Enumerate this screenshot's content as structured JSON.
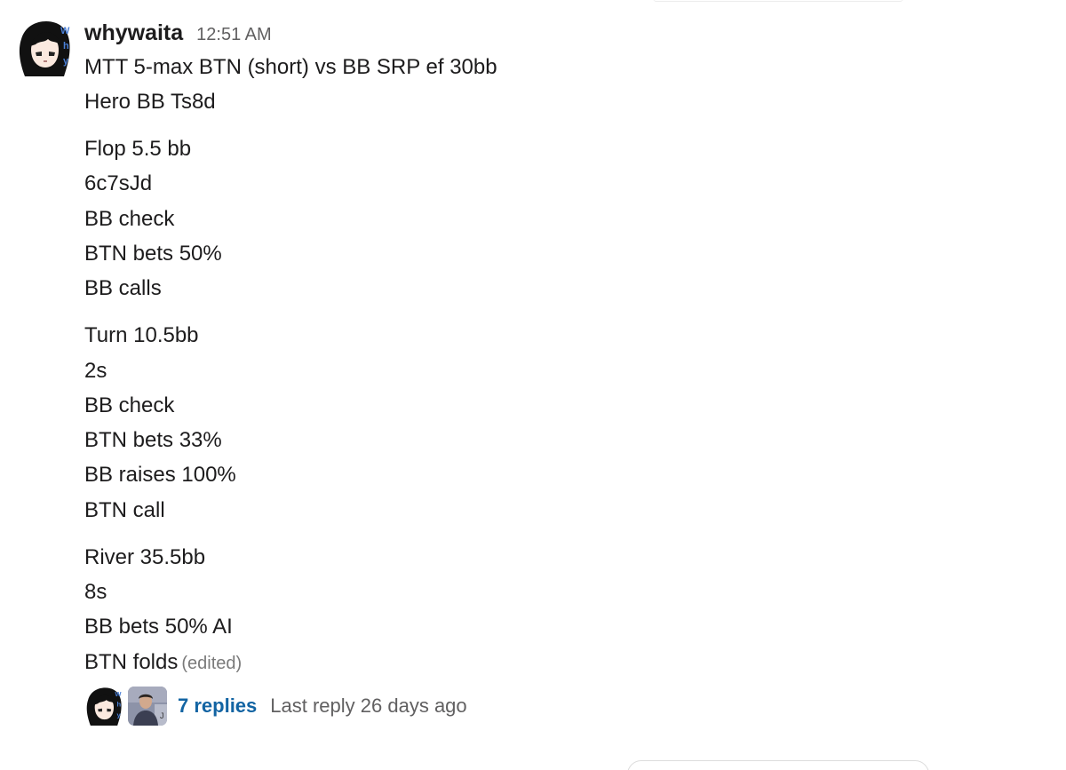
{
  "message": {
    "author": "whywaita",
    "timestamp": "12:51 AM",
    "avatar_icon": "anime-girl-avatar",
    "paragraphs": [
      [
        "MTT 5-max BTN (short) vs BB SRP ef 30bb",
        "Hero BB Ts8d"
      ],
      [
        "Flop 5.5 bb",
        "6c7sJd",
        "BB check",
        "BTN bets 50%",
        "BB calls"
      ],
      [
        "Turn 10.5bb",
        "2s",
        "BB check",
        "BTN bets 33%",
        "BB raises 100%",
        "BTN call"
      ],
      [
        "River 35.5bb",
        "8s",
        "BB bets 50% AI",
        "BTN folds"
      ]
    ],
    "edited_label": "(edited)"
  },
  "thread": {
    "participants": [
      "anime-girl-avatar",
      "man-photo-avatar"
    ],
    "replies_label": "7 replies",
    "last_reply_label": "Last reply 26 days ago"
  },
  "colors": {
    "text": "#1d1c1d",
    "muted": "#616061",
    "link": "#1264a3"
  }
}
